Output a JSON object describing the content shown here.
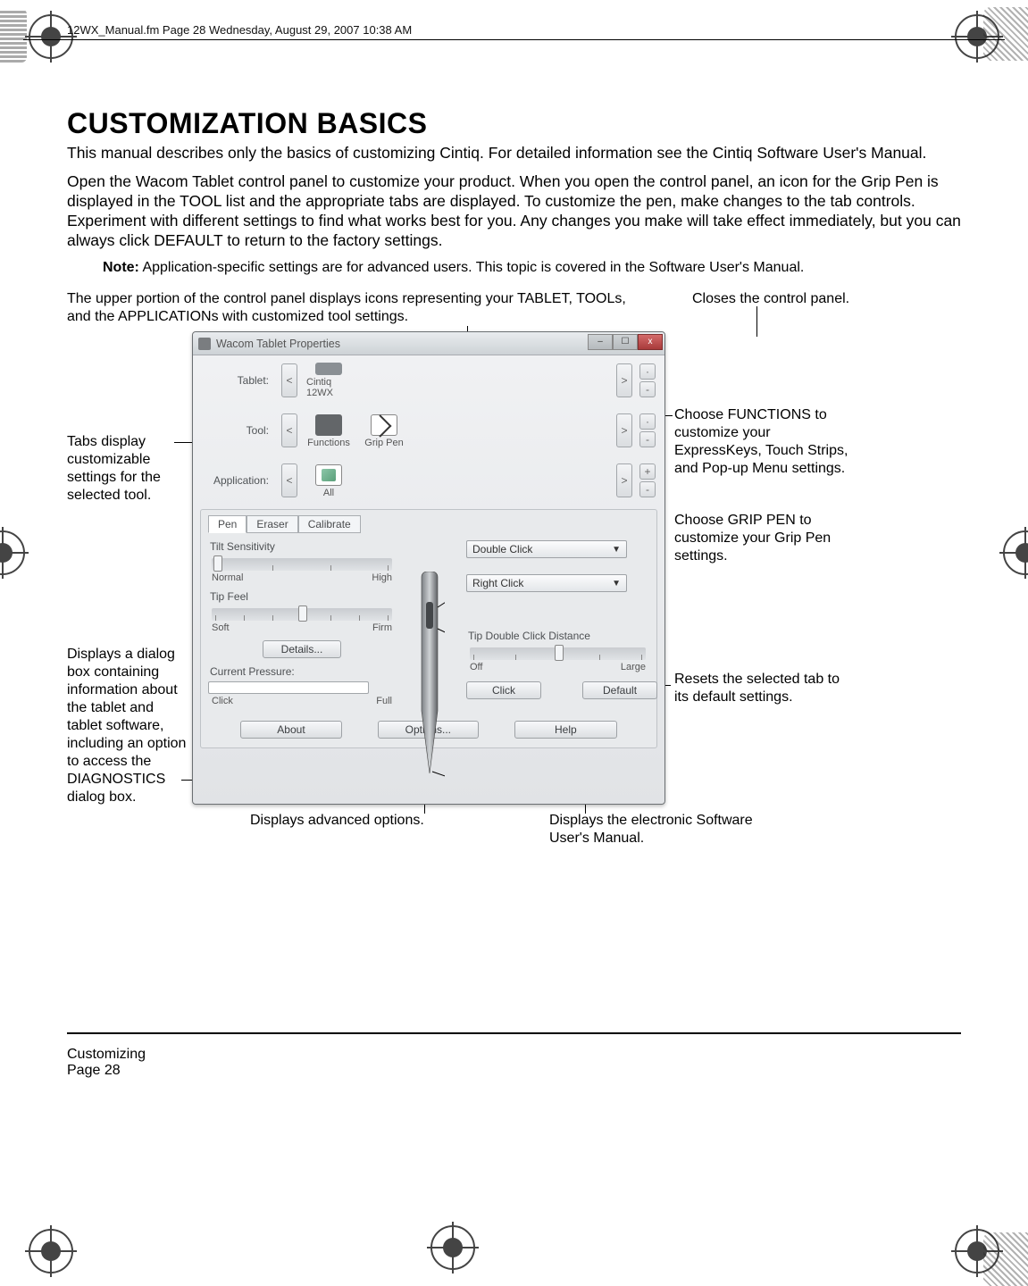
{
  "header_text": "12WX_Manual.fm  Page 28  Wednesday, August 29, 2007  10:38 AM",
  "title": "CUSTOMIZATION BASICS",
  "para1": "This manual describes only the basics of customizing Cintiq.  For detailed information see the Cintiq Software User's Manual.",
  "para2": "Open the Wacom Tablet control panel to customize your product.  When you open the control panel, an icon for the Grip Pen is displayed in the TOOL list and the appropriate tabs are displayed.  To customize the pen, make changes to the tab controls.  Experiment with different settings to find what works best for you.  Any changes you make will take effect immediately, but you can always click DEFAULT to return to the factory settings.",
  "note_label": "Note:",
  "note_text": " Application-specific settings are for advanced users.  This topic is covered in the Software User's Manual.",
  "annot_top_left": "The upper portion of the control panel displays icons representing your TABLET, TOOLs, and the APPLICATIONs with customized tool settings.",
  "annot_top_right": "Closes the control panel.",
  "annot_left1": "Tabs display customizable settings for the selected tool.",
  "annot_left2": "Displays a dialog box containing information about the tablet and tablet software, including an option to access the DIAGNOSTICS dialog box.",
  "annot_right1": "Choose FUNCTIONS to customize your ExpressKeys, Touch Strips,  and Pop-up Menu settings.",
  "annot_right2": "Choose GRIP PEN to customize your Grip Pen settings.",
  "annot_right3": "Resets the selected tab to its default settings.",
  "annot_bottom_left": "Displays advanced options.",
  "annot_bottom_right": "Displays the electronic Software User's Manual.",
  "window": {
    "title": "Wacom Tablet Properties",
    "rows": {
      "tablet_label": "Tablet:",
      "tool_label": "Tool:",
      "app_label": "Application:"
    },
    "icons": {
      "cintiq": "Cintiq 12WX",
      "functions": "Functions",
      "grippen": "Grip Pen",
      "all": "All"
    },
    "tabs": {
      "pen": "Pen",
      "eraser": "Eraser",
      "calibrate": "Calibrate"
    },
    "tilt_label": "Tilt Sensitivity",
    "tilt_low": "Normal",
    "tilt_high": "High",
    "tipfeel_label": "Tip Feel",
    "tip_low": "Soft",
    "tip_high": "Firm",
    "details": "Details...",
    "curr_pressure": "Current Pressure:",
    "cp_low": "Click",
    "cp_high": "Full",
    "dd1": "Double Click",
    "dd2": "Right Click",
    "tdc_label": "Tip Double Click Distance",
    "tdc_low": "Off",
    "tdc_high": "Large",
    "click_btn": "Click",
    "default_btn": "Default",
    "about": "About",
    "options": "Options...",
    "help": "Help"
  },
  "footer": {
    "section": "Customizing",
    "page": "Page  28"
  }
}
